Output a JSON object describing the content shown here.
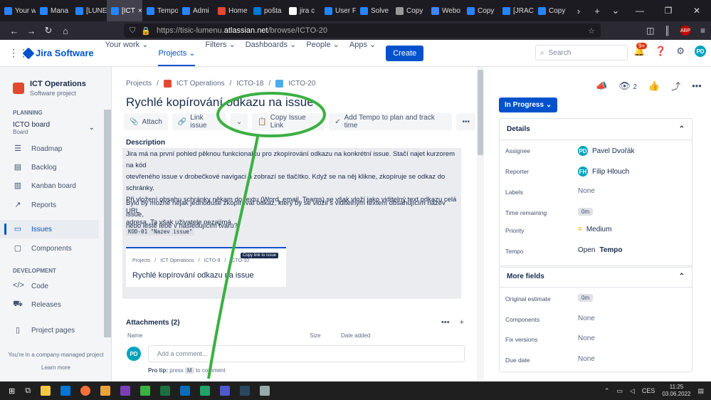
{
  "browser": {
    "tabs": [
      {
        "label": "Your w",
        "color": "#2684ff"
      },
      {
        "label": "Mana",
        "color": "#2684ff"
      },
      {
        "label": "[LUNE",
        "color": "#2684ff"
      },
      {
        "label": "[ICT",
        "color": "#2684ff"
      },
      {
        "label": "Tempo",
        "color": "#2684ff"
      },
      {
        "label": "Admi",
        "color": "#2684ff"
      },
      {
        "label": "Home",
        "color": "#e2492f"
      },
      {
        "label": "pošta",
        "color": "#0078d4"
      },
      {
        "label": "jira c",
        "color": "#fff"
      },
      {
        "label": "User F",
        "color": "#2684ff"
      },
      {
        "label": "Solve",
        "color": "#2684ff"
      },
      {
        "label": "Copy",
        "color": "#999"
      },
      {
        "label": "Webo",
        "color": "#4285f4"
      },
      {
        "label": "Copy",
        "color": "#2684ff"
      },
      {
        "label": "[JRAC",
        "color": "#2684ff"
      },
      {
        "label": "Copy",
        "color": "#2684ff"
      }
    ],
    "url_prefix": "https://tisic-lumenu.",
    "url_domain": "atlassian.net",
    "url_path": "/browse/ICTO-20"
  },
  "top": {
    "product": "Jira Software",
    "nav": [
      "Your work",
      "Projects",
      "Filters",
      "Dashboards",
      "People",
      "Apps"
    ],
    "create": "Create",
    "search_placeholder": "Search",
    "notif_count": "9+",
    "user_initials": "PD"
  },
  "sidebar": {
    "project_name": "ICT Operations",
    "project_type": "Software project",
    "planning_header": "PLANNING",
    "board_name": "ICTO board",
    "board_sub": "Board",
    "planning_items": [
      "Roadmap",
      "Backlog",
      "Kanban board",
      "Reports"
    ],
    "issues": "Issues",
    "components": "Components",
    "dev_header": "DEVELOPMENT",
    "dev_items": [
      "Code",
      "Releases"
    ],
    "project_pages": "Project pages",
    "footer": "You're in a company-managed project",
    "learn_more": "Learn more"
  },
  "issue": {
    "crumbs": [
      "Projects",
      "ICT Operations",
      "ICTO-18",
      "ICTO-20"
    ],
    "title": "Rychlé kopírování odkazu na issue",
    "toolbar": {
      "attach": "Attach",
      "link": "Link issue",
      "copy": "Copy Issue Link",
      "tempo": "Add Tempo to plan and track time"
    },
    "description_label": "Description",
    "para1": [
      "Jira má na první pohled pěknou funkcionalitu pro zkopírování odkazu na konkrétní issue. Stačí najet kurzorem na kód",
      "otevřeného issue v drobečkové navigaci a zobrazí se tlačítko. Když se na něj klikne, zkopíruje se odkaz do schránky.",
      "Při vložení obsahu schránky někam do textu (Word, email, Teams) se však vloží jako viditelný text odkazu celá URL",
      "adresa. Ta však uživatele nezajímá."
    ],
    "para2": [
      "Bylo by možné nějak jednoduše zkopírovat odkaz, který by se vložil s viditelným textem obsahujícím název issue,",
      "nebo ještě lépe v následujícím tvaru?"
    ],
    "code": "KOD-01 \"Nazev issue\"",
    "embed": {
      "crumbs": [
        "Projects",
        "ICT Operations",
        "ICTO-9",
        "ICTO-10"
      ],
      "title": "Rychlé kopírování odkazu na issue",
      "tooltip": "Copy link to issue"
    },
    "attachments": "Attachments (2)",
    "col_name": "Name",
    "col_size": "Size",
    "col_date": "Date added",
    "comment_placeholder": "Add a comment...",
    "protip_label": "Pro tip:",
    "protip_text": "press",
    "protip_key": "M",
    "protip_end": "to comment"
  },
  "right": {
    "watchers": "2",
    "status": "In Progress",
    "details": "Details",
    "fields": [
      {
        "label": "Assignee",
        "value": "Pavel Dvořák",
        "avatar": "PD",
        "color": "#00a3bf"
      },
      {
        "label": "Reporter",
        "value": "Filip Hlouch",
        "avatar": "FH",
        "color": "#00a3bf"
      },
      {
        "label": "Labels",
        "value": "None"
      },
      {
        "label": "Time remaining",
        "value": "0m"
      },
      {
        "label": "Priority",
        "value": "Medium"
      },
      {
        "label": "Tempo",
        "value_prefix": "Open",
        "value": "Tempo"
      }
    ],
    "more_fields": "More fields",
    "more": [
      {
        "label": "Original estimate",
        "value": "0m"
      },
      {
        "label": "Components",
        "value": "None"
      },
      {
        "label": "Fix versions",
        "value": "None"
      },
      {
        "label": "Due date",
        "value": "None"
      }
    ]
  },
  "taskbar": {
    "lang": "CES",
    "time": "11:25",
    "date": "03.06.2022"
  }
}
